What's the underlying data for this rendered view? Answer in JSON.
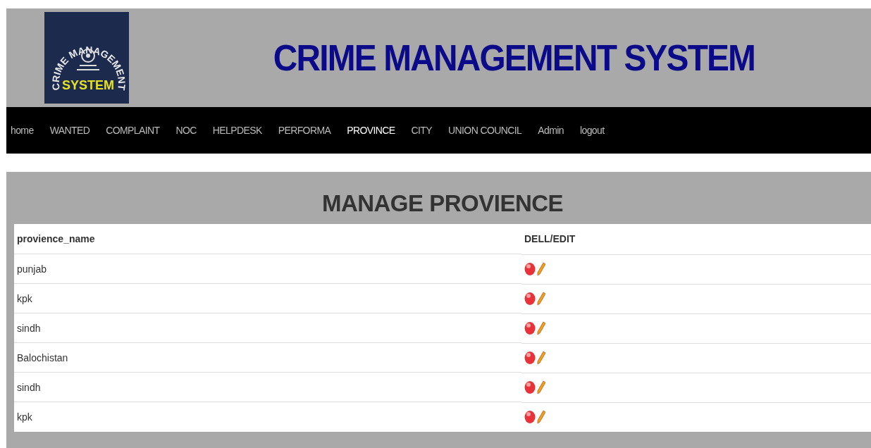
{
  "header": {
    "logo": {
      "arc_text": "CRIME MANAGEMENT",
      "bottom_text": "SYSTEM"
    },
    "title": "CRIME MANAGEMENT SYSTEM"
  },
  "nav": [
    {
      "label": "home",
      "selected": false
    },
    {
      "label": "WANTED",
      "selected": false
    },
    {
      "label": "COMPLAINT",
      "selected": false
    },
    {
      "label": "NOC",
      "selected": false
    },
    {
      "label": "HELPDESK",
      "selected": false
    },
    {
      "label": "PERFORMA",
      "selected": false
    },
    {
      "label": "PROVINCE",
      "selected": true
    },
    {
      "label": "CITY",
      "selected": false
    },
    {
      "label": "UNION COUNCIL",
      "selected": false
    },
    {
      "label": "Admin",
      "selected": false
    },
    {
      "label": "logout",
      "selected": false
    }
  ],
  "panel": {
    "title": "MANAGE PROVIENCE",
    "table": {
      "columns": [
        "provience_name",
        "DELL/EDIT"
      ],
      "rows": [
        {
          "provience_name": "punjab"
        },
        {
          "provience_name": "kpk"
        },
        {
          "provience_name": "sindh"
        },
        {
          "provience_name": "Balochistan"
        },
        {
          "provience_name": "sindh"
        },
        {
          "provience_name": "kpk"
        }
      ]
    }
  }
}
